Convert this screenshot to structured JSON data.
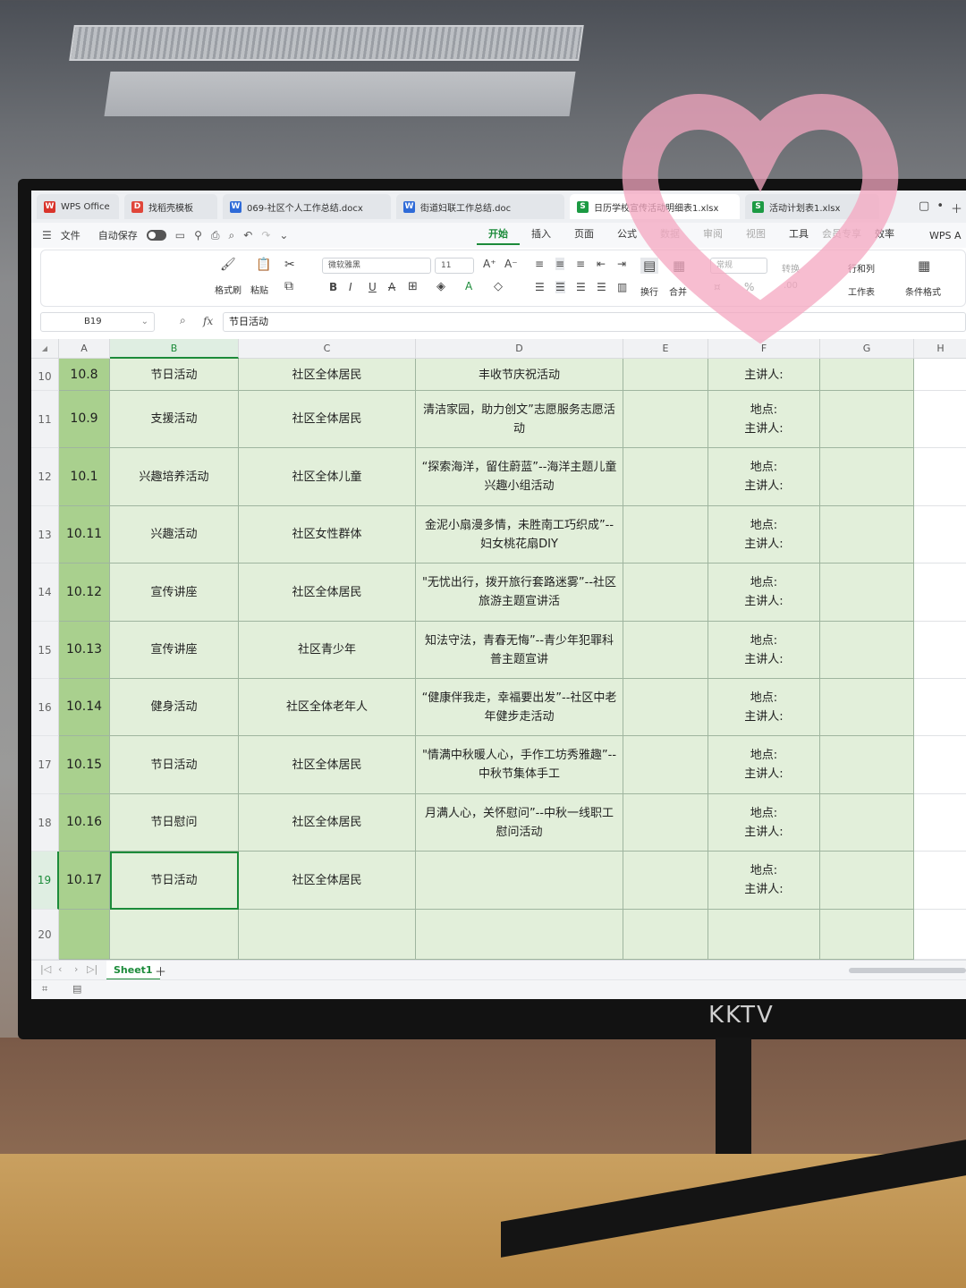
{
  "tabs": [
    {
      "label": "WPS Office",
      "icon": "W",
      "color": "#d9342b"
    },
    {
      "label": "找稻壳模板",
      "icon": "D",
      "color": "#e0463a"
    },
    {
      "label": "069-社区个人工作总结.docx",
      "icon": "W",
      "color": "#2f6bd8"
    },
    {
      "label": "街道妇联工作总结.doc",
      "icon": "W",
      "color": "#2f6bd8"
    },
    {
      "label": "日历学校宣传活动明细表1.xlsx",
      "icon": "S",
      "color": "#1c9a43"
    },
    {
      "label": "活动计划表1.xlsx",
      "icon": "S",
      "color": "#1c9a43"
    }
  ],
  "menu": {
    "file": "文件",
    "autosave": "自动保存",
    "tabs": [
      "开始",
      "插入",
      "页面",
      "公式",
      "数据",
      "审阅",
      "视图",
      "工具",
      "会员专享",
      "效率"
    ],
    "active_tab": "开始",
    "wps_ai": "WPS A"
  },
  "ribbon": {
    "format_painter": "格式刷",
    "paste": "粘贴",
    "font": "微软雅黑",
    "size": "11",
    "wrap": "换行",
    "merge": "合并",
    "number_format": "常规",
    "convert": "转换",
    "rows_cols": "行和列",
    "worksheet": "工作表",
    "cond_format": "条件格式"
  },
  "formula_bar": {
    "name_box": "B19",
    "fx": "fx",
    "content": "节日活动"
  },
  "columns": [
    "A",
    "B",
    "C",
    "D",
    "E",
    "F",
    "G",
    "H"
  ],
  "rows": [
    {
      "num": "10",
      "a": "10.8",
      "b": "节日活动",
      "c": "社区全体居民",
      "d": "丰收节庆祝活动",
      "f": "主讲人:"
    },
    {
      "num": "11",
      "a": "10.9",
      "b": "支援活动",
      "c": "社区全体居民",
      "d": "清洁家园，助力创文”志愿服务志愿活动",
      "f": "地点:\n主讲人:"
    },
    {
      "num": "12",
      "a": "10.1",
      "b": "兴趣培养活动",
      "c": "社区全体儿童",
      "d": "“探索海洋，留住蔚蓝”--海洋主题儿童兴趣小组活动",
      "f": "地点:\n主讲人:"
    },
    {
      "num": "13",
      "a": "10.11",
      "b": "兴趣活动",
      "c": "社区女性群体",
      "d": "金泥小扇漫多情，未胜南工巧织成”--妇女桃花扇DIY",
      "f": "地点:\n主讲人:"
    },
    {
      "num": "14",
      "a": "10.12",
      "b": "宣传讲座",
      "c": "社区全体居民",
      "d": "\"无忧出行，拨开旅行套路迷雾”--社区旅游主题宣讲活",
      "f": "地点:\n主讲人:"
    },
    {
      "num": "15",
      "a": "10.13",
      "b": "宣传讲座",
      "c": "社区青少年",
      "d": "知法守法，青春无悔”--青少年犯罪科普主题宣讲",
      "f": "地点:\n主讲人:"
    },
    {
      "num": "16",
      "a": "10.14",
      "b": "健身活动",
      "c": "社区全体老年人",
      "d": "“健康伴我走，幸福要出发”--社区中老年健步走活动",
      "f": "地点:\n主讲人:"
    },
    {
      "num": "17",
      "a": "10.15",
      "b": "节日活动",
      "c": "社区全体居民",
      "d": "\"情满中秋暖人心，手作工坊秀雅趣”--中秋节集体手工",
      "f": "地点:\n主讲人:"
    },
    {
      "num": "18",
      "a": "10.16",
      "b": "节日慰问",
      "c": "社区全体居民",
      "d": "月满人心，关怀慰问”--中秋一线职工慰问活动",
      "f": "地点:\n主讲人:"
    },
    {
      "num": "19",
      "a": "10.17",
      "b": "节日活动",
      "c": "社区全体居民",
      "d": "",
      "f": "地点:\n主讲人:"
    },
    {
      "num": "20",
      "a": "",
      "b": "",
      "c": "",
      "d": "",
      "f": ""
    }
  ],
  "sheet_tab": "Sheet1",
  "monitor_brand": "KKTV",
  "colors": {
    "accent": "#1c8b3a",
    "cell_fill": "#e2efda",
    "col_a_fill": "#a9d08e"
  }
}
